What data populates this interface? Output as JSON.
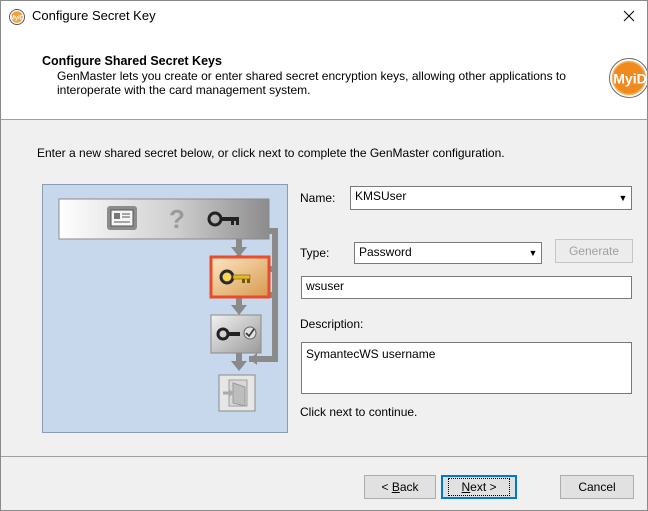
{
  "window": {
    "title": "Configure Secret Key",
    "close_glyph": "✕",
    "icon": "myid-app-icon"
  },
  "header": {
    "title": "Configure Shared Secret Keys",
    "description": "GenMaster lets you create or enter shared secret encryption keys, allowing other applications to interoperate with the card management system.",
    "logo_text": "MyiD"
  },
  "instruction": "Enter a new shared secret below, or click next to complete the GenMaster configuration.",
  "diagram": {
    "icons": [
      "card-icon",
      "question-icon",
      "key-icon",
      "key-highlighted-icon",
      "key-verified-icon",
      "exit-door-icon"
    ],
    "question_glyph": "?",
    "highlight_color": "#e84c2c"
  },
  "form": {
    "name_label": "Name:",
    "name_value": "KMSUser",
    "type_label": "Type:",
    "type_value": "Password",
    "generate_label": "Generate",
    "secret_value": "wsuser",
    "description_label": "Description:",
    "description_value": "SymantecWS username",
    "hint": "Click next to continue."
  },
  "buttons": {
    "back_prefix": "< ",
    "back_accel": "B",
    "back_rest": "ack",
    "next_accel": "N",
    "next_rest": "ext >",
    "cancel": "Cancel"
  }
}
